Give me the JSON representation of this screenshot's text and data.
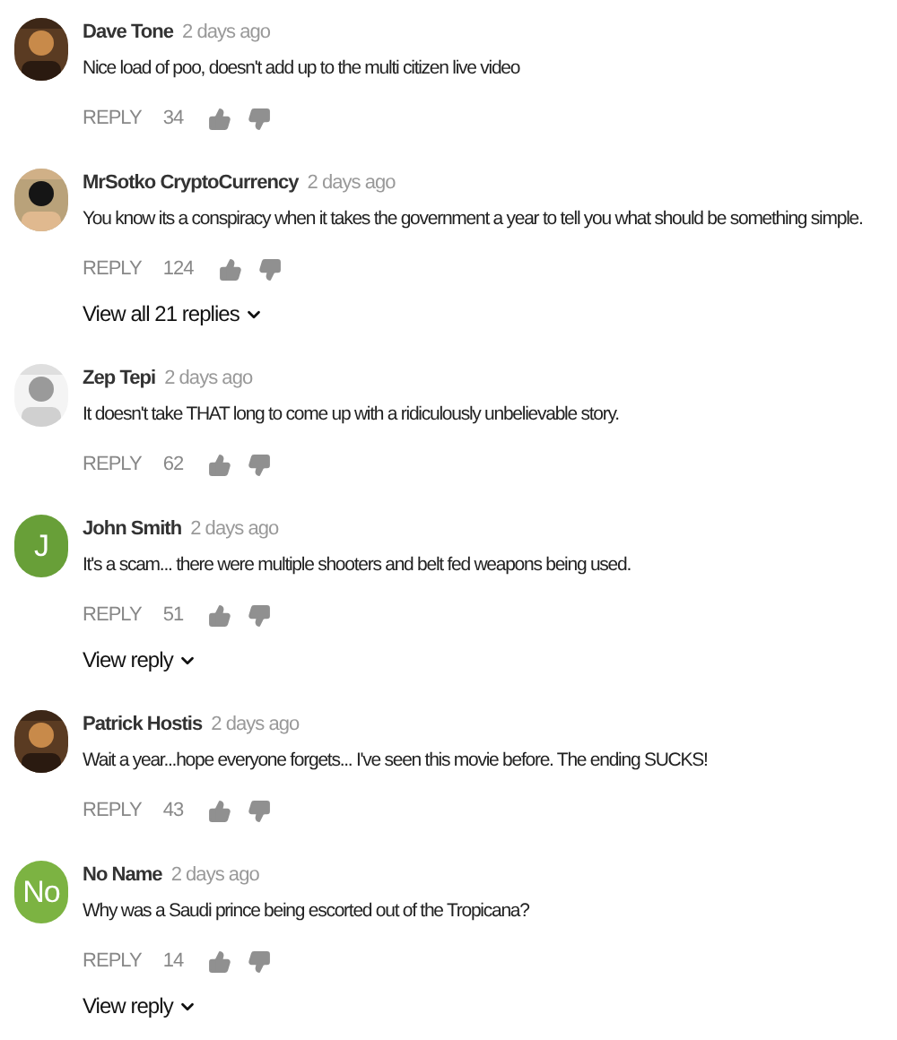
{
  "comments": [
    {
      "author": "Dave Tone",
      "time": "2 days ago",
      "text": "Nice load of poo, doesn't add up to the multi citizen live video",
      "reply_label": "REPLY",
      "likes": "34"
    },
    {
      "author": "MrSotko CryptoCurrency",
      "time": "2 days ago",
      "text": "You know its a conspiracy when it takes the government a year to tell you what should be something simple.",
      "reply_label": "REPLY",
      "likes": "124",
      "replies_link": "View all 21 replies"
    },
    {
      "author": "Zep Tepi",
      "time": "2 days ago",
      "text": "It doesn't take THAT long to come up with a ridiculously unbelievable story.",
      "reply_label": "REPLY",
      "likes": "62"
    },
    {
      "author": "John Smith",
      "time": "2 days ago",
      "text": "It's a scam... there were multiple shooters and belt fed weapons being used.",
      "reply_label": "REPLY",
      "likes": "51",
      "avatar": {
        "kind": "letter",
        "letter": "J",
        "color": "#689f38"
      },
      "replies_link": "View reply"
    },
    {
      "author": "Patrick Hostis",
      "time": "2 days ago",
      "text": "Wait a year...hope everyone forgets... I've seen this movie before. The ending SUCKS!",
      "reply_label": "REPLY",
      "likes": "43"
    },
    {
      "author": "No Name",
      "time": "2 days ago",
      "text": "Why was a Saudi prince being escorted out of the Tropicana?",
      "reply_label": "REPLY",
      "likes": "14",
      "avatar": {
        "kind": "letter",
        "letter": "No",
        "color": "#7cb342"
      },
      "replies_link": "View reply"
    }
  ]
}
